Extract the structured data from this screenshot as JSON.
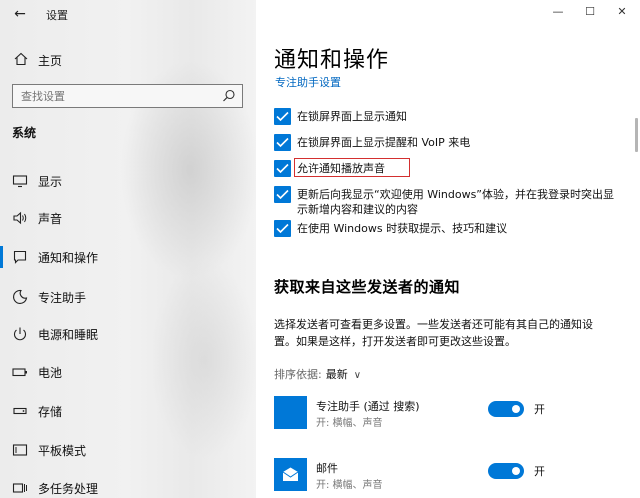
{
  "window": {
    "title": "设置",
    "back_icon": "back-arrow-icon",
    "controls": {
      "minimize": "—",
      "maximize": "☐",
      "close": "✕"
    }
  },
  "sidebar": {
    "home_label": "主页",
    "search_placeholder": "查找设置",
    "section_label": "系统",
    "items": [
      {
        "label": "显示",
        "icon": "display-icon",
        "active": false
      },
      {
        "label": "声音",
        "icon": "sound-icon",
        "active": false
      },
      {
        "label": "通知和操作",
        "icon": "notification-icon",
        "active": true
      },
      {
        "label": "专注助手",
        "icon": "moon-icon",
        "active": false
      },
      {
        "label": "电源和睡眠",
        "icon": "power-icon",
        "active": false
      },
      {
        "label": "电池",
        "icon": "battery-icon",
        "active": false
      },
      {
        "label": "存储",
        "icon": "storage-icon",
        "active": false
      },
      {
        "label": "平板模式",
        "icon": "tablet-icon",
        "active": false
      },
      {
        "label": "多任务处理",
        "icon": "multitask-icon",
        "active": false
      }
    ]
  },
  "main": {
    "title": "通知和操作",
    "link": "专注助手设置",
    "checkboxes": [
      {
        "label": "在锁屏界面上显示通知",
        "checked": true
      },
      {
        "label": "在锁屏界面上显示提醒和 VoIP 来电",
        "checked": true
      },
      {
        "label": "允许通知播放声音",
        "checked": true,
        "highlighted": true
      },
      {
        "label_line1": "更新后向我显示“欢迎使用 Windows”体验，并在我登录时突出显",
        "label_line2": "示新增内容和建议的内容",
        "checked": true
      },
      {
        "label": "在使用 Windows 时获取提示、技巧和建议",
        "checked": true
      }
    ],
    "senders_heading": "获取来自这些发送者的通知",
    "senders_desc_line1": "选择发送者可查看更多设置。一些发送者还可能有其自己的通知设",
    "senders_desc_line2": "置。如果是这样，打开发送者即可更改这些设置。",
    "sort_label": "排序依据:",
    "sort_value": "最新",
    "apps": [
      {
        "name": "专注助手 (通过 搜索)",
        "sub": "开: 横幅、声音",
        "toggle": "开",
        "on": true
      },
      {
        "name": "邮件",
        "sub": "开: 横幅、声音",
        "toggle": "开",
        "on": true
      }
    ]
  },
  "colors": {
    "accent": "#0078d7",
    "link": "#0067c0",
    "highlight_border": "#d32f2f"
  }
}
